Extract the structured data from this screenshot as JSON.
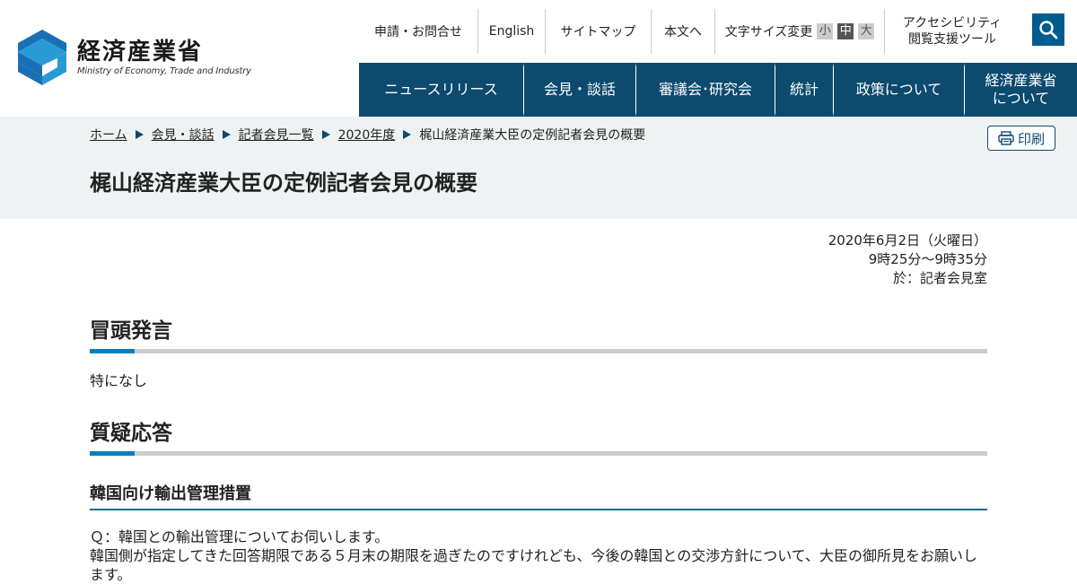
{
  "site": {
    "logo_jp": "経済産業省",
    "logo_en": "Ministry of Economy, Trade and Industry"
  },
  "utility": {
    "contact": "申請・お問合せ",
    "english": "English",
    "sitemap": "サイトマップ",
    "honbun": "本文へ",
    "fontsize_label": "文字サイズ変更",
    "fontsize_small": "小",
    "fontsize_medium": "中",
    "fontsize_large": "大",
    "accessibility_line1": "アクセシビリティ",
    "accessibility_line2": "閲覧支援ツール"
  },
  "gnav": {
    "items": [
      {
        "label": "ニュースリリース"
      },
      {
        "label": "会見・談話"
      },
      {
        "label": "審議会･研究会"
      },
      {
        "label": "統計"
      },
      {
        "label": "政策について"
      },
      {
        "label_line1": "経済産業省",
        "label_line2": "について"
      }
    ]
  },
  "breadcrumb": {
    "items": [
      "ホーム",
      "会見・談話",
      "記者会見一覧",
      "2020年度"
    ],
    "current": "梶山経済産業大臣の定例記者会見の概要"
  },
  "print_label": "印刷",
  "page_title": "梶山経済産業大臣の定例記者会見の概要",
  "meta": {
    "date": "2020年6月2日（火曜日）",
    "time": "9時25分～9時35分",
    "place": "於：記者会見室"
  },
  "sections": {
    "opening_title": "冒頭発言",
    "opening_text": "特になし",
    "qa_title": "質疑応答",
    "qa_subtitle": "韓国向け輸出管理措置",
    "q_line1": "Ｑ：韓国との輸出管理についてお伺いします。",
    "q_line2": "韓国側が指定してきた回答期限である５月末の期限を過ぎたのですけれども、今後の韓国との交渉方針について、大臣の御所見をお願いします。"
  },
  "colors": {
    "nav_bg": "#0c4a6e",
    "accent": "#0080c0",
    "band_bg": "#eef2f2"
  }
}
